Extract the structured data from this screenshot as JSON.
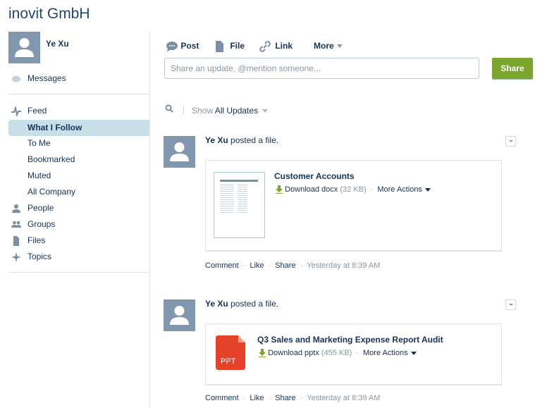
{
  "company_title": "inovit GmbH",
  "user": {
    "name": "Ye Xu"
  },
  "sidebar": {
    "messages": "Messages",
    "items": [
      {
        "label": "Feed",
        "icon": "feed-icon"
      },
      {
        "label": "What I Follow",
        "selected": true
      },
      {
        "label": "To Me"
      },
      {
        "label": "Bookmarked"
      },
      {
        "label": "Muted"
      },
      {
        "label": "All Company"
      },
      {
        "label": "People",
        "icon": "people-icon"
      },
      {
        "label": "Groups",
        "icon": "groups-icon"
      },
      {
        "label": "Files",
        "icon": "files-icon"
      },
      {
        "label": "Topics",
        "icon": "topics-icon"
      }
    ]
  },
  "publisher": {
    "tabs": [
      "Post",
      "File",
      "Link",
      "More"
    ],
    "placeholder": "Share an update, @mention someone...",
    "share_label": "Share"
  },
  "filter": {
    "show_label": "Show",
    "value": "All Updates"
  },
  "colors": {
    "accent": "#16325c",
    "share": "#7ba62e",
    "selected": "#c7dfe6",
    "ppt": "#e4432a"
  },
  "posts": [
    {
      "author": "Ye Xu",
      "action": "posted a file.",
      "file_title": "Customer Accounts",
      "download": "Download docx",
      "size": "(32 KB)",
      "more": "More Actions",
      "actions": [
        "Comment",
        "Like",
        "Share"
      ],
      "time": "Yesterday at 8:39 AM"
    },
    {
      "author": "Ye Xu",
      "action": "posted a file.",
      "file_title": "Q3 Sales and Marketing Expense Report Audit",
      "download": "Download pptx",
      "size": "(455 KB)",
      "more": "More Actions",
      "file_badge": "PPT",
      "actions": [
        "Comment",
        "Like",
        "Share"
      ],
      "time": "Yesterday at 8:39 AM"
    }
  ]
}
